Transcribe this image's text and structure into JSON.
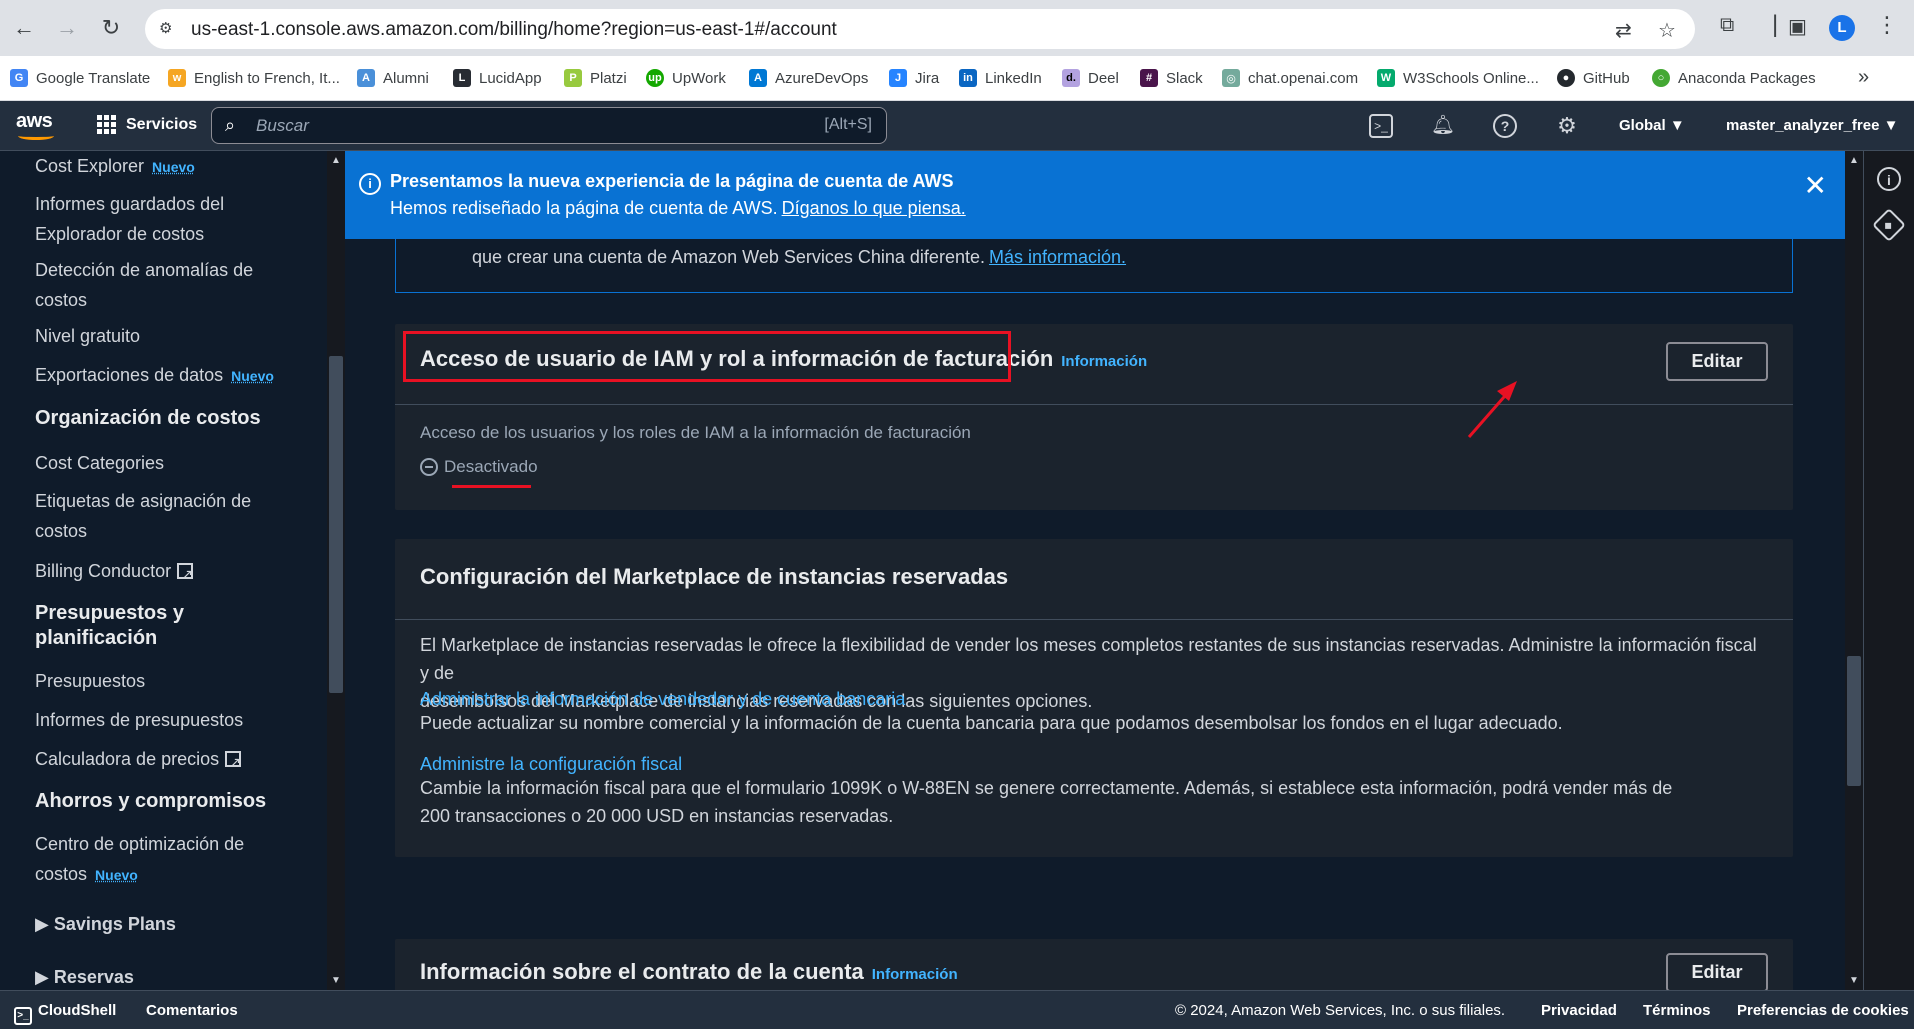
{
  "browser": {
    "url": "us-east-1.console.aws.amazon.com/billing/home?region=us-east-1#/account",
    "profile_initial": "L",
    "bookmarks": [
      {
        "label": "Google Translate",
        "color": "#4285f4",
        "glyph": "G"
      },
      {
        "label": "English to French, It...",
        "color": "#f5a623",
        "glyph": "w"
      },
      {
        "label": "Alumni",
        "color": "#4a90d9",
        "glyph": "A"
      },
      {
        "label": "LucidApp",
        "color": "#282c33",
        "glyph": "L"
      },
      {
        "label": "Platzi",
        "color": "#98ca3f",
        "glyph": "P"
      },
      {
        "label": "UpWork",
        "color": "#14a800",
        "glyph": "up"
      },
      {
        "label": "AzureDevOps",
        "color": "#0078d4",
        "glyph": "A"
      },
      {
        "label": "Jira",
        "color": "#2684ff",
        "glyph": "J"
      },
      {
        "label": "LinkedIn",
        "color": "#0a66c2",
        "glyph": "in"
      },
      {
        "label": "Deel",
        "color": "#b3a2e0",
        "glyph": "d."
      },
      {
        "label": "Slack",
        "color": "#4a154b",
        "glyph": "#"
      },
      {
        "label": "chat.openai.com",
        "color": "#74aa9c",
        "glyph": "◎"
      },
      {
        "label": "W3Schools Online...",
        "color": "#04aa6d",
        "glyph": "W"
      },
      {
        "label": "GitHub",
        "color": "#24292e",
        "glyph": "●"
      },
      {
        "label": "Anaconda Packages",
        "color": "#44a833",
        "glyph": "○"
      }
    ]
  },
  "aws_nav": {
    "logo": "aws",
    "services_label": "Servicios",
    "search_placeholder": "Buscar",
    "search_shortcut": "[Alt+S]",
    "region_label": "Global",
    "account_label": "master_analyzer_free"
  },
  "sidebar": {
    "cost_explorer": "Cost Explorer",
    "new_badge": "Nuevo",
    "saved_reports_1": "Informes guardados del",
    "saved_reports_2": "Explorador de costos",
    "anomaly_1": "Detección de anomalías de",
    "anomaly_2": "costos",
    "free_tier": "Nivel gratuito",
    "data_exports": "Exportaciones de datos",
    "org_heading": "Organización de costos",
    "cost_categories": "Cost Categories",
    "tags_1": "Etiquetas de asignación de",
    "tags_2": "costos",
    "billing_conductor": "Billing Conductor",
    "budgets_heading_1": "Presupuestos y",
    "budgets_heading_2": "planificación",
    "budgets": "Presupuestos",
    "budget_reports": "Informes de presupuestos",
    "pricing_calc": "Calculadora de precios",
    "savings_heading": "Ahorros y compromisos",
    "optimization_1": "Centro de optimización de",
    "optimization_2": "costos",
    "savings_plans": "Savings Plans",
    "reservations": "Reservas"
  },
  "flash": {
    "title": "Presentamos la nueva experiencia de la página de cuenta de AWS",
    "subtitle": "Hemos rediseñado la página de cuenta de AWS.",
    "link": "Díganos lo que piensa."
  },
  "prev_card": {
    "text": "que crear una cuenta de Amazon Web Services China diferente.",
    "link": "Más información."
  },
  "iam_card": {
    "title": "Acceso de usuario de IAM y rol a información de facturación",
    "info": "Información",
    "edit": "Editar",
    "label": "Acceso de los usuarios y los roles de IAM a la información de facturación",
    "status": "Desactivado"
  },
  "marketplace_card": {
    "title": "Configuración del Marketplace de instancias reservadas",
    "desc_1": "El Marketplace de instancias reservadas le ofrece la flexibilidad de vender los meses completos restantes de sus instancias reservadas. Administre la información fiscal y de",
    "desc_2": "desembolsos del Marketplace de instancias reservadas con las siguientes opciones.",
    "seller_link": "Administrar la información de vendedor y de cuenta bancaria",
    "seller_desc": "Puede actualizar su nombre comercial y la información de la cuenta bancaria para que podamos desembolsar los fondos en el lugar adecuado.",
    "tax_link": "Administre la configuración fiscal",
    "tax_desc_1": "Cambie la información fiscal para que el formulario 1099K o W-88EN se genere correctamente. Además, si establece esta información, podrá vender más de",
    "tax_desc_2": "200 transacciones o 20 000 USD en instancias reservadas."
  },
  "contract_card": {
    "title": "Información sobre el contrato de la cuenta",
    "info": "Información",
    "edit": "Editar"
  },
  "footer": {
    "cloudshell": "CloudShell",
    "feedback": "Comentarios",
    "copyright": "© 2024, Amazon Web Services, Inc. o sus filiales.",
    "privacy": "Privacidad",
    "terms": "Términos",
    "cookies": "Preferencias de cookies"
  },
  "colors": {
    "annotation": "#e81123",
    "flash_bg": "#0972d3",
    "link": "#42b4ff"
  }
}
